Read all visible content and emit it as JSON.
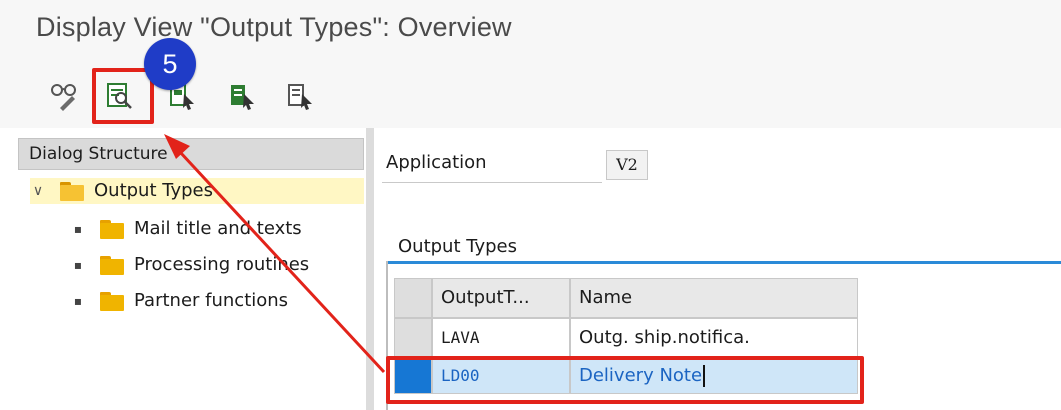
{
  "window": {
    "title": "Display View \"Output Types\": Overview"
  },
  "toolbar": {
    "buttons": [
      {
        "icon": "glasses-pencil-icon"
      },
      {
        "icon": "position-search-icon"
      },
      {
        "icon": "select-block-icon"
      },
      {
        "icon": "select-all-icon"
      },
      {
        "icon": "deselect-all-icon"
      }
    ],
    "step_badge": "5"
  },
  "dialog_structure": {
    "header": "Dialog Structure",
    "root_item": "Output Types",
    "children": [
      "Mail title and texts",
      "Processing routines",
      "Partner functions"
    ]
  },
  "form": {
    "application_label": "Application",
    "application_value": "V2"
  },
  "table": {
    "section_title": "Output Types",
    "columns": [
      "OutputT...",
      "Name"
    ],
    "rows": [
      {
        "code": "LAVA",
        "name": "Outg. ship.notifica."
      },
      {
        "code": "LD00",
        "name": "Delivery Note"
      }
    ]
  },
  "colors": {
    "annotation_red": "#e2231a",
    "badge_blue": "#1f3cc7",
    "selection_blue": "#1677d4",
    "section_line": "#2a8ad8",
    "tree_selected": "#fff7c4"
  }
}
